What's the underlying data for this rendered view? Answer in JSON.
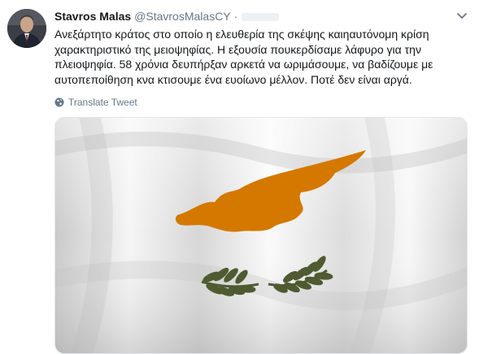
{
  "tweet": {
    "author_name": "Stavros Malas",
    "author_handle": "@StavrosMalasCY",
    "separator": "·",
    "text_lines": [
      "Ανεξάρτητο κράτος στο οποίο η ελευθερία της σκέψης καιηαυτόνομη κρίση",
      "χαρακτηριστικό της μειοψηφίας. Η εξουσία πουκερδίσαμε λάφυρο για την",
      "πλειοψηφία.  58 χρόνια δευπήρξαν  αρκετά να ωριμάσουμε, να βαδίζουμε με",
      "αυτοπεποίθηση κνα κτισουμε ένα ευοίωνο μέλλον. Ποτέ δεν είναι αργά."
    ],
    "translate_label": "Translate Tweet",
    "media": {
      "subject": "flag-of-cyprus",
      "colors": {
        "copper": "#d57800",
        "olive": "#4e5b31",
        "white": "#f7f7f7"
      }
    }
  },
  "colors": {
    "text": "#14171a",
    "secondary": "#657786",
    "border": "#e1e8ed"
  },
  "icons": {
    "caret": "chevron-down-icon",
    "globe": "globe-icon"
  }
}
